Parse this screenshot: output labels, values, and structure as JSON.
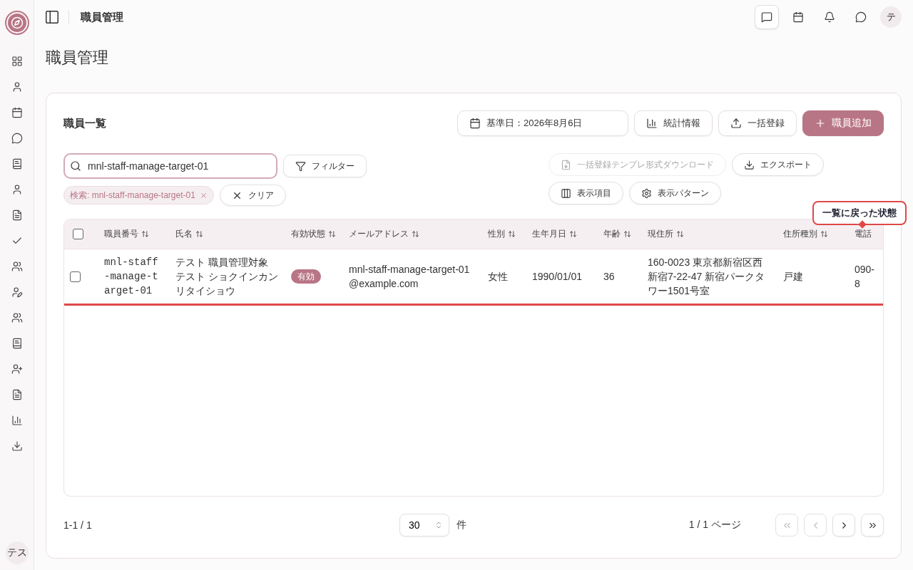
{
  "header": {
    "title": "職員管理",
    "icons": [
      {
        "selected": true
      },
      {
        "selected": false
      },
      {
        "selected": false
      },
      {
        "selected": false
      }
    ],
    "avatar": "テ"
  },
  "sidebar": {
    "avatar": "テス"
  },
  "page_title": "職員管理",
  "card": {
    "title": "職員一覧",
    "date_button": "基準日：2026年8月6日",
    "buttons": [
      {
        "label": "統計情報",
        "kind": "stats"
      },
      {
        "label": "一括登録",
        "kind": "upload"
      },
      {
        "label": "職員追加",
        "kind": "primary"
      }
    ]
  },
  "search": {
    "value": "mnl-staff-manage-target-01"
  },
  "filter_button": "フィルター",
  "tools": [
    {
      "label": "一括登録テンプレ形式ダウンロード",
      "kind": "template",
      "disabled": true
    },
    {
      "label": "エクスポート",
      "kind": "export",
      "disabled": false
    },
    {
      "label": "表示項目",
      "kind": "columns",
      "disabled": false
    },
    {
      "label": "表示パターン",
      "kind": "pattern",
      "disabled": false
    }
  ],
  "active_filter": {
    "chip": "検索: mnl-staff-manage-target-01",
    "clear": "クリア"
  },
  "table": {
    "select_all": false,
    "columns": [
      {
        "label": "職員番号",
        "sortable": true
      },
      {
        "label": "氏名",
        "sortable": true
      },
      {
        "label": "有効状態",
        "sortable": true
      },
      {
        "label": "メールアドレス",
        "sortable": true
      },
      {
        "label": "性別",
        "sortable": true
      },
      {
        "label": "生年月日",
        "sortable": true
      },
      {
        "label": "年齢",
        "sortable": true
      },
      {
        "label": "現住所",
        "sortable": true
      },
      {
        "label": "住所種別",
        "sortable": true
      },
      {
        "label": "電話",
        "sortable": false
      }
    ],
    "rows": [
      {
        "checked": false,
        "highlighted": true,
        "cells": [
          {
            "kind": "mono",
            "text": "mnl-staff-manage-target-01"
          },
          {
            "kind": "name",
            "text": "テスト 職員管理対象",
            "kana": "テスト ショクインカンリタイショウ"
          },
          {
            "kind": "badge",
            "text": "有効"
          },
          {
            "kind": "text",
            "text": "mnl-staff-manage-target-01@example.com"
          },
          {
            "kind": "text",
            "text": "女性"
          },
          {
            "kind": "text",
            "text": "1990/01/01"
          },
          {
            "kind": "text",
            "text": "36"
          },
          {
            "kind": "text",
            "text": "160-0023 東京都新宿区西新宿7-22-47 新宿パークタワー1501号室"
          },
          {
            "kind": "text",
            "text": "戸建"
          },
          {
            "kind": "text",
            "text": "090-8"
          }
        ]
      }
    ]
  },
  "tooltip": "一覧に戻った状態",
  "footer": {
    "range": "1-1 / 1",
    "page_size": "30",
    "unit": "件",
    "page": "1 / 1 ページ",
    "nav": [
      {
        "kind": "first",
        "disabled": true
      },
      {
        "kind": "prev",
        "disabled": true
      },
      {
        "kind": "next",
        "disabled": false
      },
      {
        "kind": "last",
        "disabled": false
      }
    ]
  }
}
